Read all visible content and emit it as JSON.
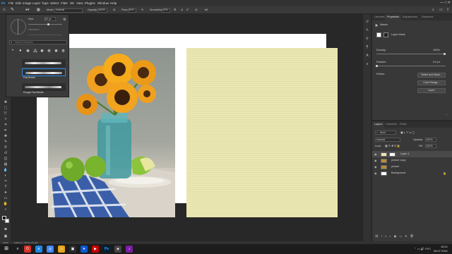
{
  "menubar": {
    "items": [
      "File",
      "Edit",
      "Image",
      "Layer",
      "Type",
      "Select",
      "Filter",
      "3D",
      "View",
      "Plugins",
      "Window",
      "Help"
    ],
    "window_controls": "—  □  ✕"
  },
  "options": {
    "mode_label": "Mode:",
    "mode_value": "Normal",
    "opacity_label": "Opacity:",
    "opacity_value": "100%",
    "flow_label": "Flow:",
    "flow_value": "40%",
    "smoothing_label": "Smoothing:",
    "smoothing_value": "10%",
    "angle_value": "0°"
  },
  "brush_panel": {
    "size_label": "Size:",
    "size_value": "62 px",
    "hardness_label": "Hardness:",
    "search_placeholder": "Search Brushes",
    "brushes": [
      "Flat Bristle",
      "Rough Flat Bristle"
    ]
  },
  "properties": {
    "tabs": [
      "Libraries",
      "Properties",
      "Adjustments",
      "Swatches"
    ],
    "section_label": "Masks",
    "layer_mask_label": "Layer Mask",
    "density_label": "Density:",
    "density_value": "100%",
    "feather_label": "Feather:",
    "feather_value": "0.0 px",
    "refine_label": "Refine:",
    "buttons": [
      "Select and Mask...",
      "Color Range...",
      "Invert"
    ]
  },
  "layers_panel": {
    "tabs": [
      "Layers",
      "Channels",
      "Paths"
    ],
    "kind_label": "Kind",
    "blend_mode": "Normal",
    "opacity_label": "Opacity:",
    "opacity_value": "100%",
    "lock_label": "Lock:",
    "fill_label": "Fill:",
    "fill_value": "100%",
    "layers": [
      "Layer 1",
      "picture copy",
      "picture",
      "Background"
    ]
  },
  "status": {
    "zoom": "100%",
    "doc_size": "1280 px x 720 px (72 ppi)"
  },
  "taskbar": {
    "time": "18:21",
    "date": "28.07.2021",
    "language": "РУС"
  },
  "colors": {
    "accent": "#2d8ceb",
    "texture": "#ebe7b2",
    "panel_bg": "#383838"
  }
}
